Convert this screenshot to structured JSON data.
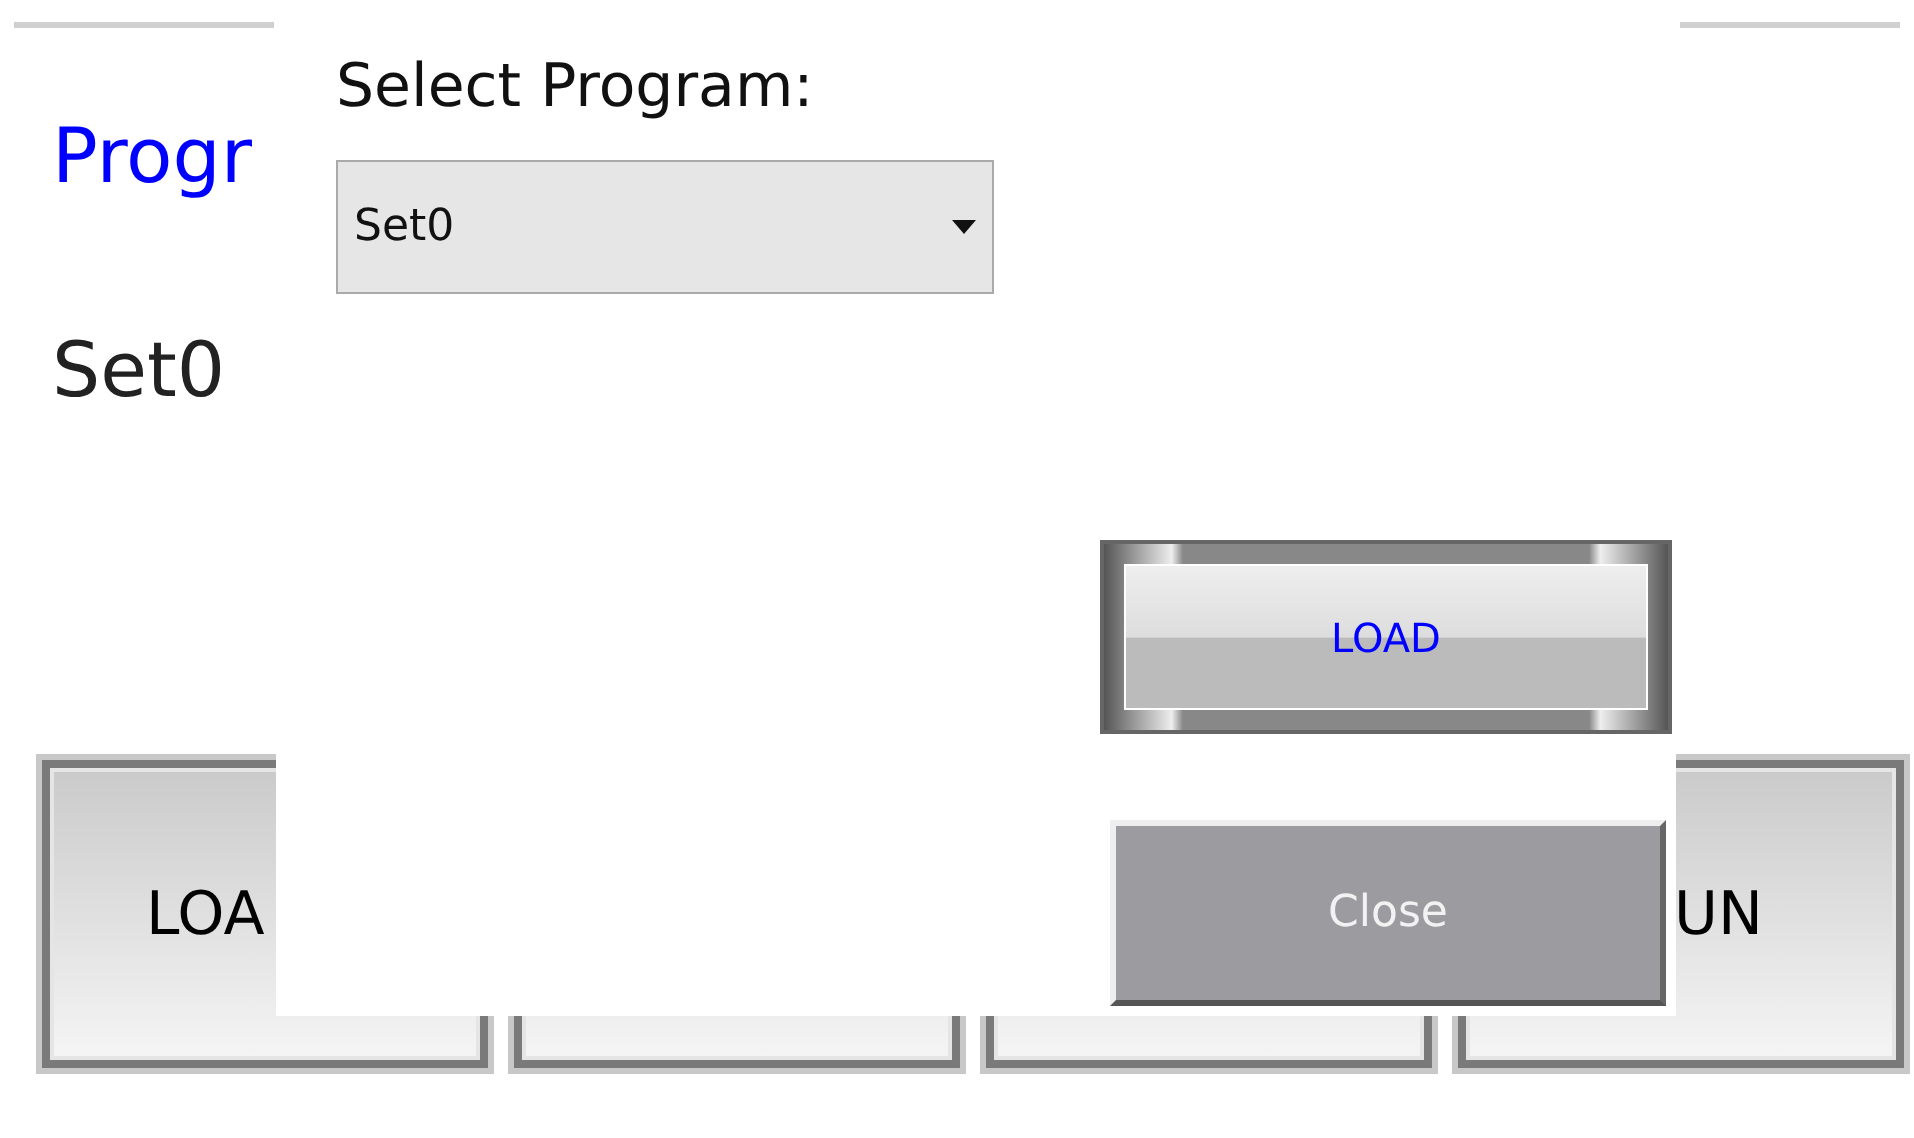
{
  "page": {
    "title": "Progr",
    "program_name": "Set0"
  },
  "bottom_buttons": [
    {
      "kind": "labeled",
      "label": "LOA"
    },
    {
      "kind": "blank"
    },
    {
      "kind": "blank"
    },
    {
      "kind": "labeled",
      "label": "UN"
    }
  ],
  "dialog": {
    "label": "Select Program:",
    "dropdown": {
      "value": "Set0"
    },
    "load_button": "LOAD",
    "close_button": "Close"
  }
}
